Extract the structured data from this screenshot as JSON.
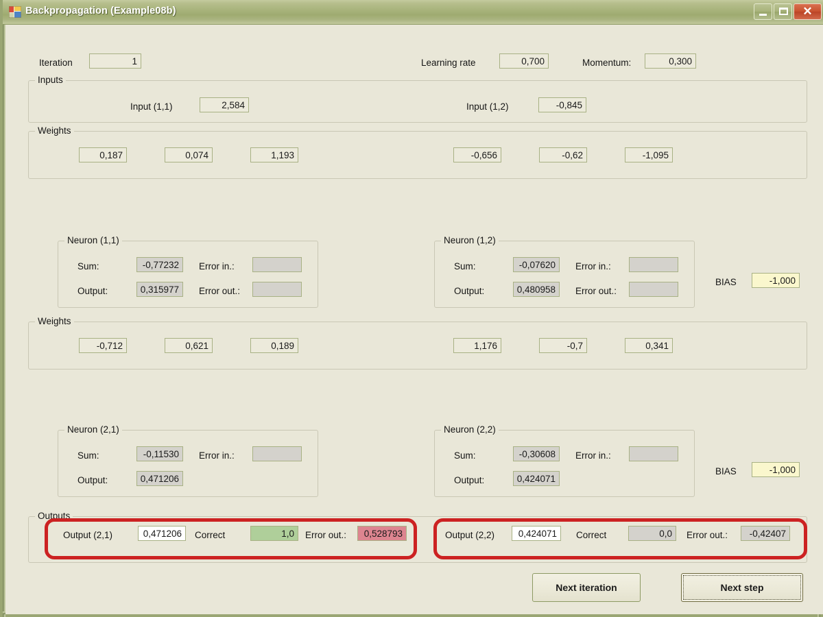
{
  "window": {
    "title": "Backpropagation (Example08b)",
    "icon": "form-icon",
    "minimize_label": "",
    "maximize_label": "",
    "close_label": "✕"
  },
  "header": {
    "iteration_label": "Iteration",
    "iteration_value": "1",
    "learning_rate_label": "Learning rate",
    "learning_rate_value": "0,700",
    "momentum_label": "Momentum:",
    "momentum_value": "0,300"
  },
  "inputs_group": {
    "title": "Inputs",
    "items": [
      {
        "label": "Input (1,1)",
        "value": "2,584"
      },
      {
        "label": "Input (1,2)",
        "value": "-0,845"
      }
    ]
  },
  "weights_group_1": {
    "title": "Weights",
    "values": [
      "0,187",
      "0,074",
      "1,193",
      "-0,656",
      "-0,62",
      "-1,095"
    ]
  },
  "weights_group_2": {
    "title": "Weights",
    "values": [
      "-0,712",
      "0,621",
      "0,189",
      "1,176",
      "-0,7",
      "0,341"
    ]
  },
  "layer1": {
    "neuron_11": {
      "title": "Neuron (1,1)",
      "sum_label": "Sum:",
      "sum_value": "-0,77232",
      "output_label": "Output:",
      "output_value": "0,315977",
      "error_in_label": "Error in.:",
      "error_in_value": "",
      "error_out_label": "Error out.:",
      "error_out_value": ""
    },
    "neuron_12": {
      "title": "Neuron (1,2)",
      "sum_label": "Sum:",
      "sum_value": "-0,07620",
      "output_label": "Output:",
      "output_value": "0,480958",
      "error_in_label": "Error in.:",
      "error_in_value": "",
      "error_out_label": "Error out.:",
      "error_out_value": ""
    },
    "bias_label": "BIAS",
    "bias_value": "-1,000"
  },
  "layer2": {
    "neuron_21": {
      "title": "Neuron (2,1)",
      "sum_label": "Sum:",
      "sum_value": "-0,11530",
      "output_label": "Output:",
      "output_value": "0,471206",
      "error_in_label": "Error in.:",
      "error_in_value": ""
    },
    "neuron_22": {
      "title": "Neuron (2,2)",
      "sum_label": "Sum:",
      "sum_value": "-0,30608",
      "output_label": "Output:",
      "output_value": "0,424071",
      "error_in_label": "Error in.:",
      "error_in_value": ""
    },
    "bias_label": "BIAS",
    "bias_value": "-1,000"
  },
  "outputs_group": {
    "title": "Outputs",
    "output_21": {
      "label": "Output (2,1)",
      "value": "0,471206",
      "correct_label": "Correct",
      "correct_value": "1,0",
      "error_out_label": "Error out.:",
      "error_out_value": "0,528793"
    },
    "output_22": {
      "label": "Output (2,2)",
      "value": "0,424071",
      "correct_label": "Correct",
      "correct_value": "0,0",
      "error_out_label": "Error out.:",
      "error_out_value": "-0,42407"
    }
  },
  "footer": {
    "next_iteration_label": "Next iteration",
    "next_step_label": "Next step"
  },
  "colors": {
    "form_background": "#e9e7d8",
    "titlebar": "#a9b47d",
    "field_border": "#a8b184",
    "readonly_field": "#d4d2cc",
    "bias_field": "#faf7cd",
    "correct_green": "#afcf9a",
    "error_red": "#dd8590",
    "annotation_red": "#cc2222",
    "close_button": "#c9522f"
  }
}
